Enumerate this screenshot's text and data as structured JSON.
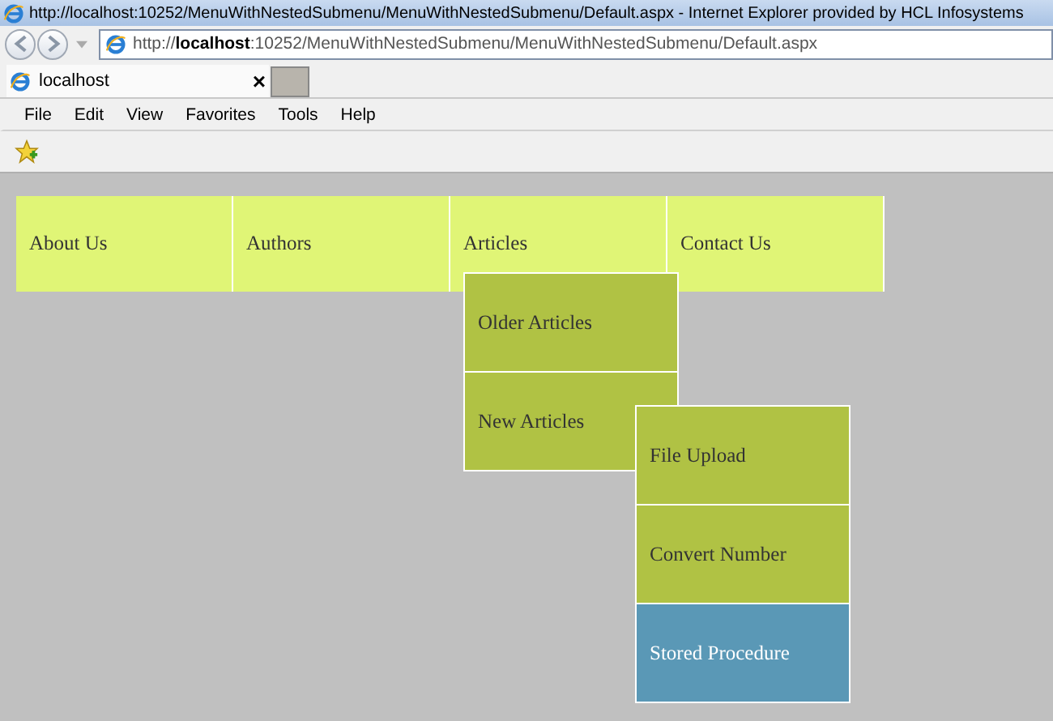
{
  "window": {
    "title": "http://localhost:10252/MenuWithNestedSubmenu/MenuWithNestedSubmenu/Default.aspx - Internet Explorer provided by HCL Infosystems"
  },
  "address_bar": {
    "url": "http://**localhost**:10252/MenuWithNestedSubmenu/MenuWithNestedSubmenu/Default.aspx"
  },
  "tabs": [
    {
      "label": "localhost",
      "close": "×",
      "selected": true
    }
  ],
  "menu_bar": [
    "File",
    "Edit",
    "View",
    "Favorites",
    "Tools",
    "Help"
  ],
  "menu": [
    {
      "label": "About Us",
      "selected": false
    },
    {
      "label": "Authors",
      "selected": false
    },
    {
      "label": "Articles",
      "selected": false,
      "expanded": true,
      "children": [
        {
          "label": "Older Articles",
          "selected": false
        },
        {
          "label": "New Articles",
          "selected": false,
          "expanded": true,
          "children": [
            {
              "label": "File Upload",
              "selected": false
            },
            {
              "label": "Convert Number",
              "selected": false
            },
            {
              "label": "Stored Procedure",
              "selected": true
            }
          ]
        }
      ]
    },
    {
      "label": "Contact Us",
      "selected": false
    }
  ]
}
